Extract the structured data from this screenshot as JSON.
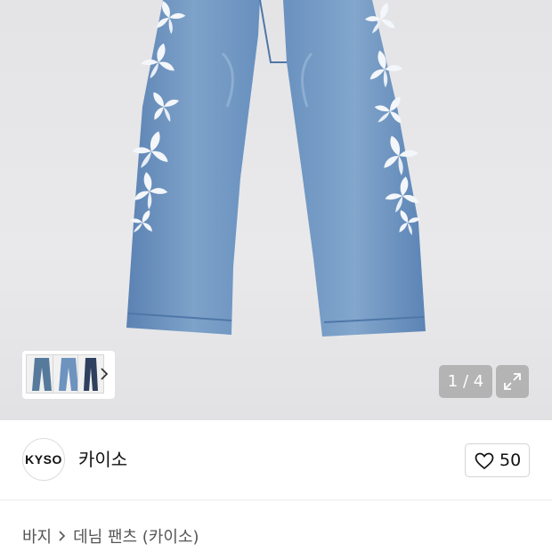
{
  "gallery": {
    "counter": "1 / 4",
    "thumbnails": [
      "thumbnail-1",
      "thumbnail-2",
      "thumbnail-3"
    ],
    "icons": {
      "next": "chevron-right-icon",
      "expand": "expand-icon"
    }
  },
  "brand": {
    "logo_text": "KYSO",
    "name": "카이소",
    "like_count": "50",
    "like_icon": "heart-icon"
  },
  "breadcrumb": {
    "category": "바지",
    "product": "데님 팬츠 (카이소)"
  },
  "colors": {
    "denim": "#6d93bf",
    "overlay": "#969696",
    "text": "#111111",
    "muted": "#555555"
  }
}
